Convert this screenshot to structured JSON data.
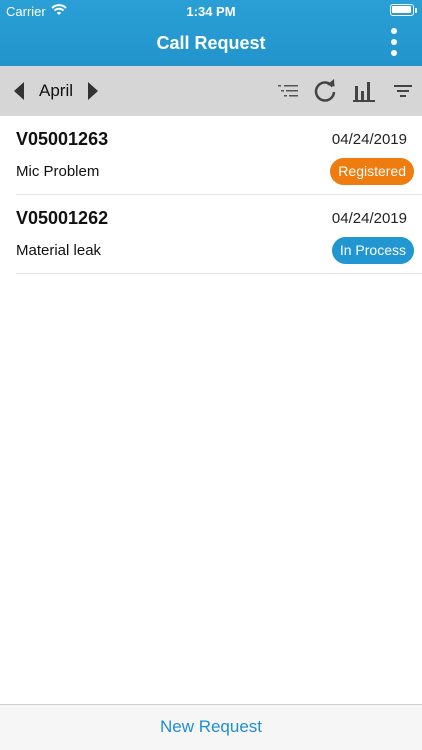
{
  "status_bar": {
    "carrier": "Carrier",
    "time": "1:34 PM"
  },
  "nav": {
    "title": "Call Request"
  },
  "toolbar": {
    "month": "April"
  },
  "requests": [
    {
      "id": "V05001263",
      "date": "04/24/2019",
      "subject": "Mic Problem",
      "status": "Registered",
      "status_color": "#ef7c0f"
    },
    {
      "id": "V05001262",
      "date": "04/24/2019",
      "subject": "Material leak",
      "status": "In Process",
      "status_color": "#2196d0"
    }
  ],
  "footer": {
    "new_request_label": "New Request"
  },
  "colors": {
    "header_blue": "#2194cc",
    "toolbar_gray": "#d6d6d6",
    "link_blue": "#1f8fcf"
  }
}
